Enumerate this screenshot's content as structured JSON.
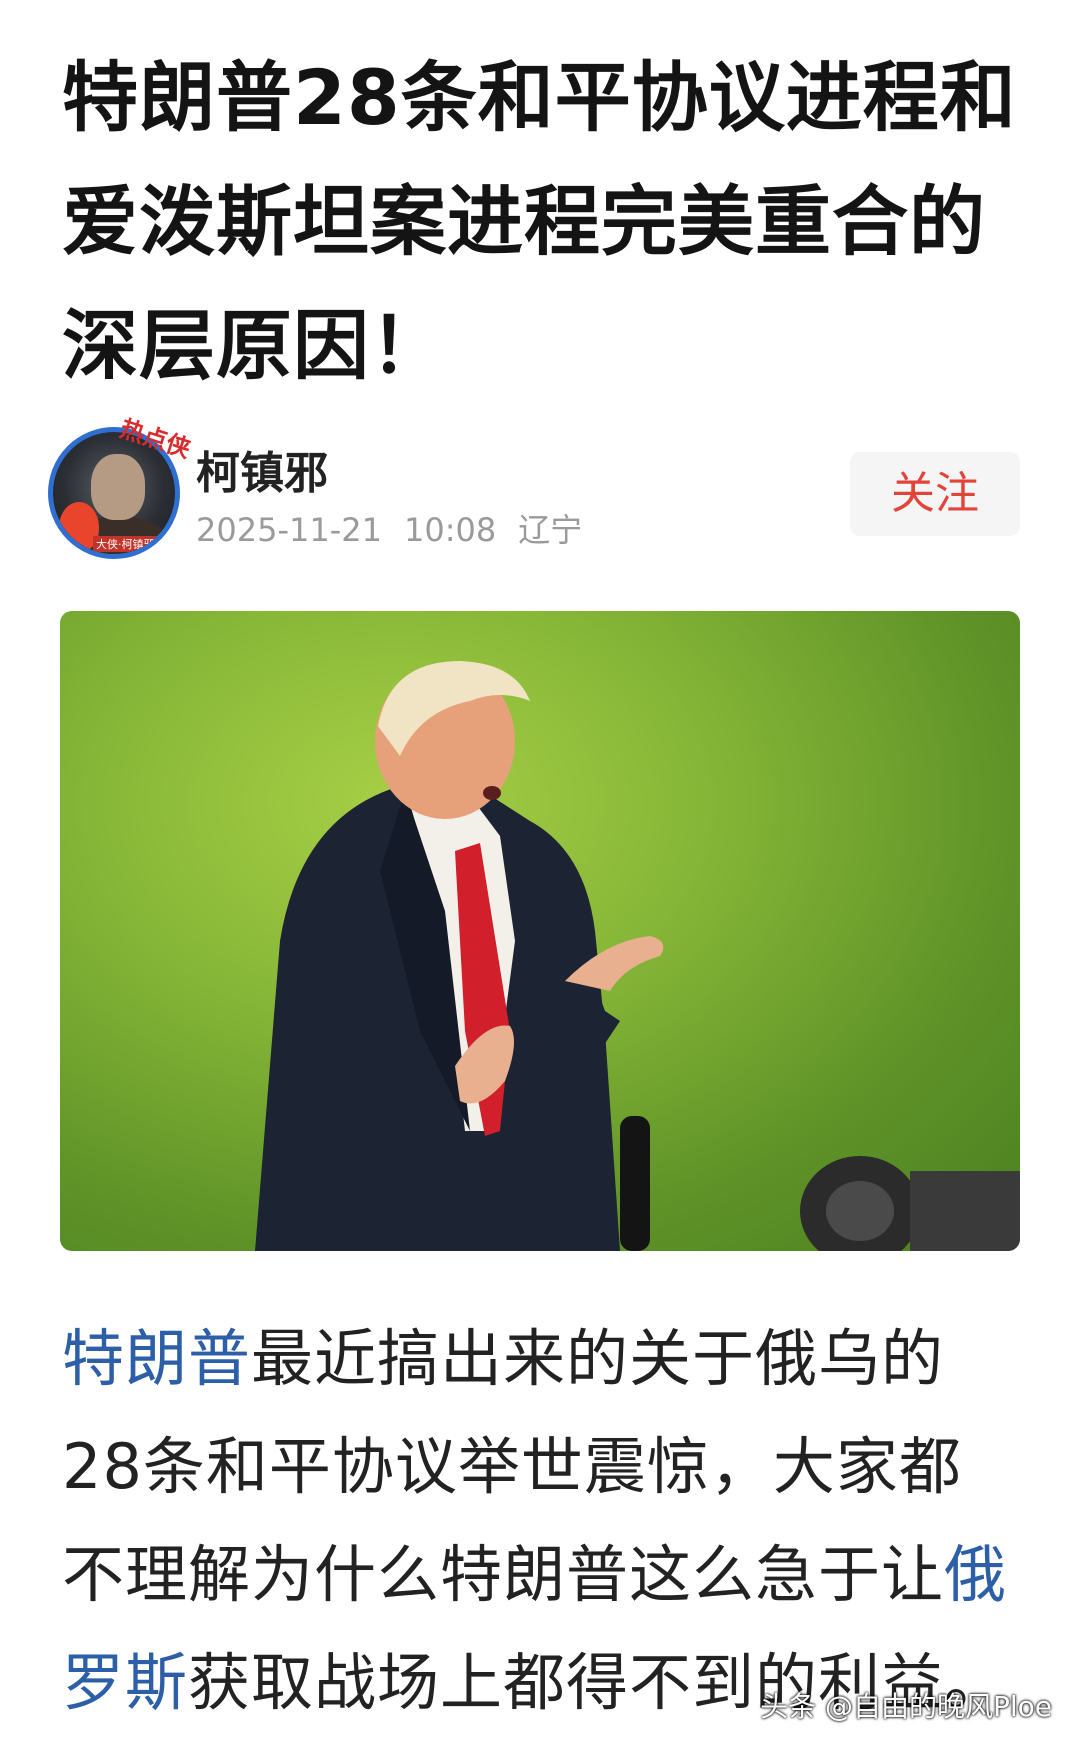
{
  "article": {
    "title": "特朗普28条和平协议进程和爱泼斯坦案进程完美重合的深层原因！",
    "author": {
      "name": "柯镇邪",
      "date": "2025-11-21",
      "time": "10:08",
      "location": "辽宁",
      "avatar_badge": "热点侠",
      "avatar_tag": "大侠·柯镇邪"
    },
    "follow_label": "关注",
    "body": {
      "link1": "特朗普",
      "text1": "最近搞出来的关于俄乌的28条和平协议举世震惊，大家都不理解为什么特朗普这么急于让",
      "link2": "俄罗斯",
      "text2": "获取战场上都得不到的利益。"
    }
  },
  "watermark": "头条 @自由的晚风Ploe",
  "colors": {
    "follow_text": "#e2443a",
    "link": "#2d5fa8",
    "avatar_ring": "#2f6fd1"
  }
}
